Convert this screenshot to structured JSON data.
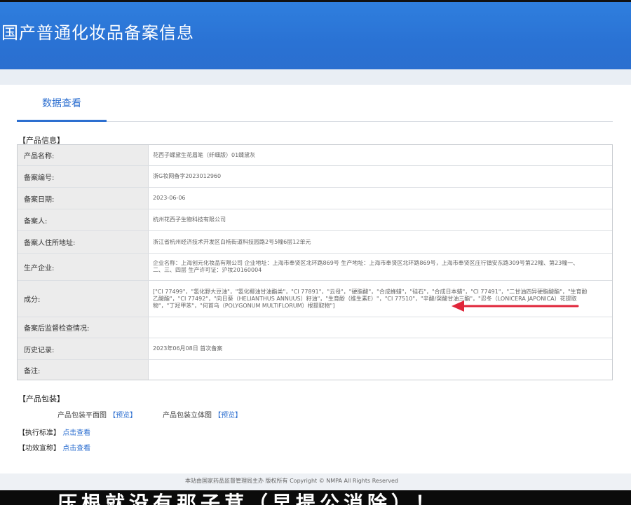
{
  "header": {
    "title": "国产普通化妆品备案信息"
  },
  "tabs": [
    {
      "label": "数据查看"
    }
  ],
  "product_info": {
    "section_title": "【产品信息】",
    "rows": [
      {
        "label": "产品名称:",
        "value": "花西子蝶黛生花眉笔（纤细版）01蝶黛灰"
      },
      {
        "label": "备案编号:",
        "value": "浙G妆网备字2023012960"
      },
      {
        "label": "备案日期:",
        "value": "2023-06-06"
      },
      {
        "label": "备案人:",
        "value": "杭州花西子生物科技有限公司"
      },
      {
        "label": "备案人住所地址:",
        "value": "浙江省杭州经济技术开发区白杨街道科技园路2号5幢6层12单元"
      },
      {
        "label": "生产企业:",
        "value": "企业名称：上海创元化妆品有限公司 企业地址：上海市奉贤区北环路869号 生产地址：上海市奉贤区北环路869号，上海市奉贤区庄行镇安东路309号第22幢、第23幢一、二、三、四层 生产许可证：沪妆20160004"
      },
      {
        "label": "成分:",
        "value": "[\"CI 77499\"，\"氢化野大豆油\"，\"氢化椰油甘油酯类\"，\"CI 77891\"，\"云母\"，\"硬脂酸\"，\"合成蜂蜡\"，\"硅石\"，\"合成日本蜡\"，\"CI 77491\"，\"二甘油四异硬脂酸酯\"，\"生育酚乙酸酯\"，\"CI 77492\"，\"向日葵（HELIANTHUS ANNUUS）籽油\"，\"生育酚（维生素E）\"，\"CI 77510\"，\"辛酸/癸酸甘油三酯\"，\"忍冬（LONICERA JAPONICA）花提取物\"，\"丁羟甲苯\"，\"何首乌（POLYGONUM MULTIFLORUM）根提取物\"]"
      },
      {
        "label": "备案后监督检查情况:",
        "value": ""
      },
      {
        "label": "历史记录:",
        "value": "2023年06月08日 首次备案"
      },
      {
        "label": "备注:",
        "value": ""
      }
    ]
  },
  "packaging": {
    "section_title": "【产品包装】",
    "flat_label": "产品包装平面图",
    "flat_link": "【预览】",
    "solid_label": "产品包装立体图",
    "solid_link": "【预览】"
  },
  "standards": {
    "label": "【执行标准】",
    "link": "点击查看"
  },
  "claims": {
    "label": "【功效宣称】",
    "link": "点击查看"
  },
  "footer": {
    "text": "本站由国家药品监督管理局主办 版权所有 Copyright © NMPA All Rights Reserved"
  },
  "caption": {
    "text": "压根就没有那子茸（早提公消除）！"
  },
  "colors": {
    "header_blue": "#2b74d6",
    "link_blue": "#2d6fd0",
    "arrow_red": "#e0263a"
  }
}
